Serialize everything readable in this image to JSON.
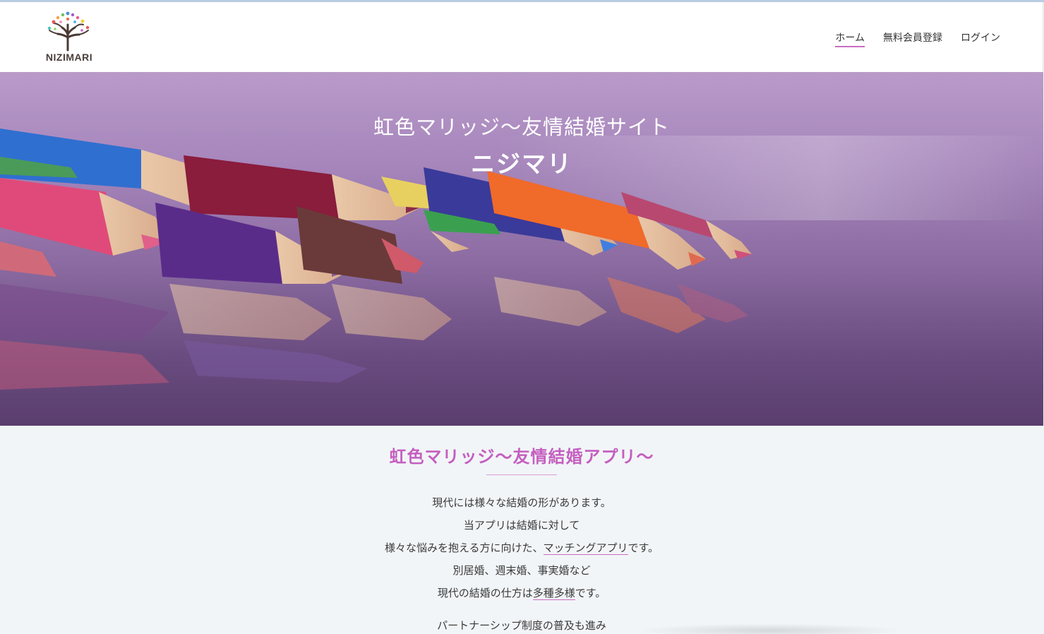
{
  "header": {
    "logo_text": "NIZIMARI",
    "nav": [
      {
        "label": "ホーム",
        "active": true
      },
      {
        "label": "無料会員登録",
        "active": false
      },
      {
        "label": "ログイン",
        "active": false
      }
    ]
  },
  "hero": {
    "subtitle": "虹色マリッジ〜友情結婚サイト",
    "title": "ニジマリ"
  },
  "main": {
    "section_title": "虹色マリッジ〜友情結婚アプリ〜",
    "lines": [
      {
        "text": "現代には様々な結婚の形があります。"
      },
      {
        "text": "当アプリは結婚に対して"
      },
      {
        "pre": "様々な悩みを抱える方に向けた、",
        "link": "マッチングアプリ",
        "post": "です。"
      },
      {
        "text": "別居婚、週末婚、事実婚など"
      },
      {
        "pre": "現代の結婚の仕方は",
        "link": "多種多様",
        "post": "です。"
      },
      {
        "text": "パートナーシップ制度の普及も進み"
      }
    ]
  },
  "colors": {
    "accent": "#c45fc0",
    "underline": "#c86cc0",
    "background": "#f2f5f8"
  }
}
